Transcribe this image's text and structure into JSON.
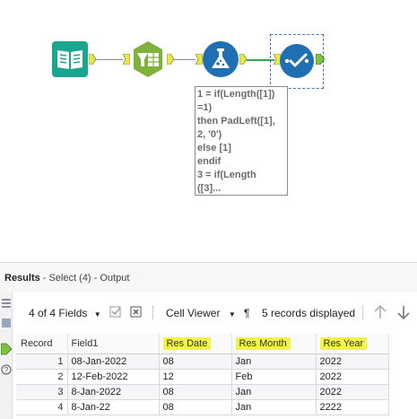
{
  "workflow": {
    "annotation": "1 = if(Length([1])\n=1)\nthen PadLeft([1],\n2, '0')\nelse [1]\nendif\n3 = if(Length\n([3]...",
    "tools": [
      {
        "name": "input-data-tool",
        "color": "#1aa58f"
      },
      {
        "name": "text-to-columns-tool",
        "color": "#7fb23b"
      },
      {
        "name": "formula-tool",
        "color": "#1f6fb2"
      },
      {
        "name": "select-tool",
        "color": "#1f6fb2"
      }
    ]
  },
  "results": {
    "title": "Results",
    "subtitle": " - Select (4) - Output",
    "fields_label": "4 of 4 Fields",
    "cell_viewer_label": "Cell Viewer",
    "records_label": "5 records displayed",
    "pilcrow": "¶",
    "columns": [
      "Record",
      "Field1",
      "Res Date",
      "Res Month",
      "Res Year"
    ],
    "highlight_color": "#f3f34a",
    "rows": [
      [
        "1",
        "08-Jan-2022",
        "08",
        "Jan",
        "2022"
      ],
      [
        "2",
        "12-Feb-2022",
        "12",
        "Feb",
        "2022"
      ],
      [
        "3",
        "8-Jan-2022",
        "08",
        "Jan",
        "2022"
      ],
      [
        "4",
        "8-Jan-22",
        "08",
        "Jan",
        "2222"
      ]
    ]
  }
}
